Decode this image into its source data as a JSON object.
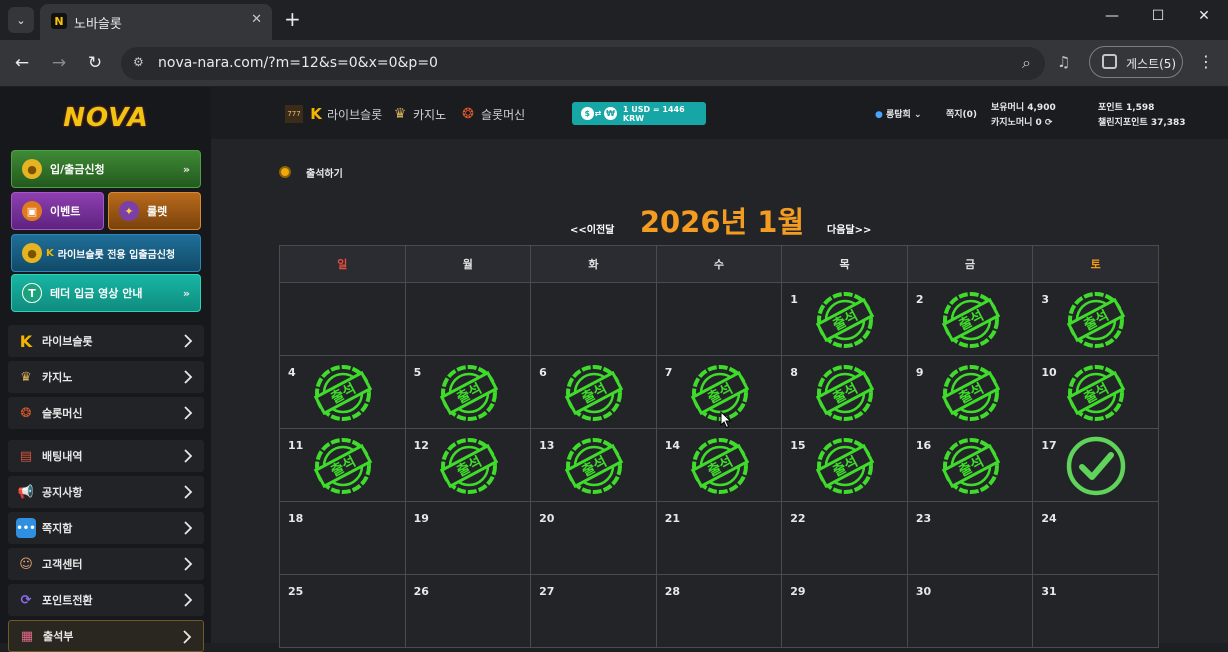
{
  "browser": {
    "tab_title": "노바슬롯",
    "favicon_letter": "N",
    "url": "nova-nara.com/?m=12&s=0&x=0&p=0",
    "profile_label": "게스트(5)"
  },
  "sidebar": {
    "logo": "NOVA",
    "buttons": [
      {
        "label": "입/출금신청",
        "icon": "coins-icon"
      },
      {
        "label": "이벤트",
        "icon": "gift-icon"
      },
      {
        "label": "룰렛",
        "icon": "roulette-icon"
      },
      {
        "label": "라이브슬롯 전용 입출금신청",
        "icon": "live-slot-coins-icon"
      },
      {
        "label": "테더 입금 영상 안내",
        "icon": "tether-icon"
      }
    ],
    "items": [
      {
        "label": "라이브슬롯",
        "icon": "live-slot-icon"
      },
      {
        "label": "카지노",
        "icon": "casino-icon"
      },
      {
        "label": "슬롯머신",
        "icon": "slot-machine-icon"
      },
      {
        "label": "배팅내역",
        "icon": "bet-history-icon"
      },
      {
        "label": "공지사항",
        "icon": "megaphone-icon"
      },
      {
        "label": "쪽지함",
        "icon": "message-icon"
      },
      {
        "label": "고객센터",
        "icon": "support-icon"
      },
      {
        "label": "포인트전환",
        "icon": "point-convert-icon"
      },
      {
        "label": "출석부",
        "icon": "attendance-icon"
      }
    ]
  },
  "topbar": {
    "categories": [
      {
        "label": "라이브슬롯",
        "icon": "live-slot-icon"
      },
      {
        "label": "카지노",
        "icon": "casino-icon"
      },
      {
        "label": "슬롯머신",
        "icon": "slot-machine-icon"
      }
    ],
    "rate": "1 USD = 1446 KRW",
    "user": "롱탐희",
    "messages": "쪽지(0)",
    "money_label": "보유머니 4,900",
    "casino_money_label": "카지노머니 0",
    "points_label": "포인트 1,598",
    "challenge_points_label": "챌린지포인트 37,383"
  },
  "attendance": {
    "title": "출석하기",
    "prev": "<<이전달",
    "next": "다음달>>",
    "month_title": "2026년 1월",
    "weekdays": [
      "일",
      "월",
      "화",
      "수",
      "목",
      "금",
      "토"
    ],
    "stamp_text": "출석",
    "weeks": [
      [
        null,
        null,
        null,
        null,
        1,
        2,
        3
      ],
      [
        4,
        5,
        6,
        7,
        8,
        9,
        10
      ],
      [
        11,
        12,
        13,
        14,
        15,
        16,
        17
      ],
      [
        18,
        19,
        20,
        21,
        22,
        23,
        24
      ],
      [
        25,
        26,
        27,
        28,
        29,
        30,
        31
      ]
    ],
    "stamped_days": [
      1,
      2,
      3,
      4,
      5,
      6,
      7,
      8,
      9,
      10,
      11,
      12,
      13,
      14,
      15,
      16
    ],
    "today": 17,
    "stamp_color": "#3fdc2b",
    "check_color": "#5fd35a"
  }
}
